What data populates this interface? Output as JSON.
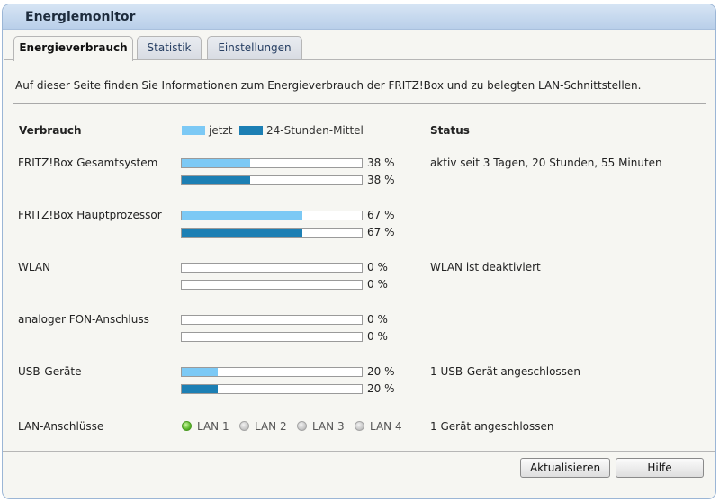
{
  "window": {
    "title": "Energiemonitor"
  },
  "tabs": [
    {
      "label": "Energieverbrauch",
      "active": true
    },
    {
      "label": "Statistik",
      "active": false
    },
    {
      "label": "Einstellungen",
      "active": false
    }
  ],
  "intro": "Auf dieser Seite finden Sie Informationen zum Energieverbrauch der FRITZ!Box und zu belegten LAN-Schnittstellen.",
  "headers": {
    "verbrauch": "Verbrauch",
    "status": "Status"
  },
  "legend": {
    "now_label": "jetzt",
    "avg_label": "24-Stunden-Mittel",
    "now_color": "#7cc9f5",
    "avg_color": "#1c7fb4"
  },
  "rows": [
    {
      "label": "FRITZ!Box Gesamtsystem",
      "now_pct": 38,
      "now_text": "38 %",
      "avg_pct": 38,
      "avg_text": "38 %",
      "status": "aktiv seit 3 Tagen, 20 Stunden, 55 Minuten"
    },
    {
      "label": "FRITZ!Box Hauptprozessor",
      "now_pct": 67,
      "now_text": "67 %",
      "avg_pct": 67,
      "avg_text": "67 %",
      "status": ""
    },
    {
      "label": "WLAN",
      "now_pct": 0,
      "now_text": "0 %",
      "avg_pct": 0,
      "avg_text": "0 %",
      "status": "WLAN ist deaktiviert"
    },
    {
      "label": "analoger FON-Anschluss",
      "now_pct": 0,
      "now_text": "0 %",
      "avg_pct": 0,
      "avg_text": "0 %",
      "status": ""
    },
    {
      "label": "USB-Geräte",
      "now_pct": 20,
      "now_text": "20 %",
      "avg_pct": 20,
      "avg_text": "20 %",
      "status": "1 USB-Gerät angeschlossen"
    }
  ],
  "lan": {
    "label": "LAN-Anschlüsse",
    "ports": [
      {
        "name": "LAN 1",
        "connected": true
      },
      {
        "name": "LAN 2",
        "connected": false
      },
      {
        "name": "LAN 3",
        "connected": false
      },
      {
        "name": "LAN 4",
        "connected": false
      }
    ],
    "status": "1 Gerät angeschlossen"
  },
  "buttons": {
    "refresh": "Aktualisieren",
    "help": "Hilfe"
  }
}
